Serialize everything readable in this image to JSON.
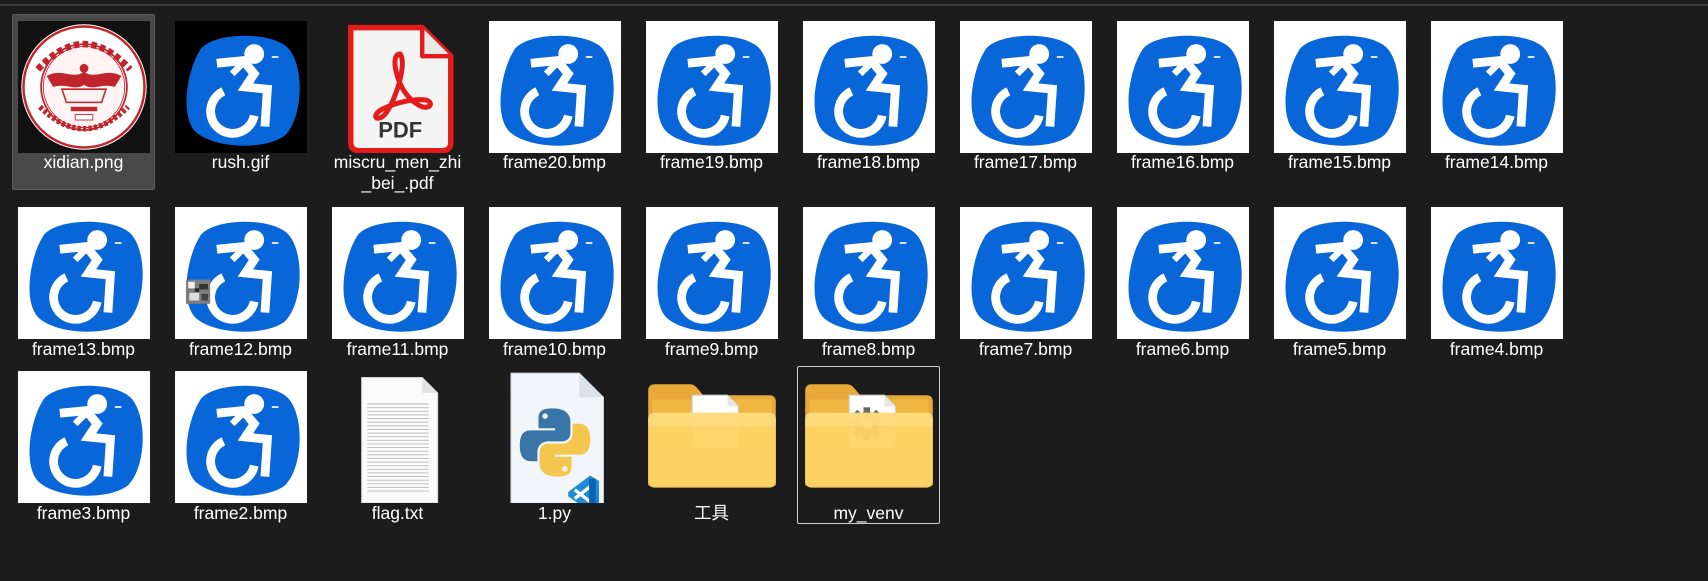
{
  "view": "large-icons",
  "colors": {
    "background": "#1c1c1c",
    "selection": "#494949",
    "icon_blue": "#0866d9",
    "text": "#ffffff"
  },
  "files": [
    {
      "name": "xidian.png",
      "icon": "xidian-logo-thumbnail",
      "kind": "logo",
      "state": "selected"
    },
    {
      "name": "rush.gif",
      "icon": "wheelchair-thumbnail",
      "kind": "gif"
    },
    {
      "name": "miscru_men_zhi_bei_.pdf",
      "icon": "pdf-file-icon",
      "kind": "pdf"
    },
    {
      "name": "frame20.bmp",
      "icon": "wheelchair-thumbnail",
      "kind": "frame"
    },
    {
      "name": "frame19.bmp",
      "icon": "wheelchair-thumbnail",
      "kind": "frame"
    },
    {
      "name": "frame18.bmp",
      "icon": "wheelchair-thumbnail",
      "kind": "frame"
    },
    {
      "name": "frame17.bmp",
      "icon": "wheelchair-thumbnail",
      "kind": "frame"
    },
    {
      "name": "frame16.bmp",
      "icon": "wheelchair-thumbnail",
      "kind": "frame"
    },
    {
      "name": "frame15.bmp",
      "icon": "wheelchair-thumbnail",
      "kind": "frame"
    },
    {
      "name": "frame14.bmp",
      "icon": "wheelchair-thumbnail",
      "kind": "frame"
    },
    {
      "name": "frame13.bmp",
      "icon": "wheelchair-thumbnail",
      "kind": "frame"
    },
    {
      "name": "frame12.bmp",
      "icon": "wheelchair-thumbnail",
      "kind": "frame12"
    },
    {
      "name": "frame11.bmp",
      "icon": "wheelchair-thumbnail",
      "kind": "frame"
    },
    {
      "name": "frame10.bmp",
      "icon": "wheelchair-thumbnail",
      "kind": "frame"
    },
    {
      "name": "frame9.bmp",
      "icon": "wheelchair-thumbnail",
      "kind": "frame"
    },
    {
      "name": "frame8.bmp",
      "icon": "wheelchair-thumbnail",
      "kind": "frame"
    },
    {
      "name": "frame7.bmp",
      "icon": "wheelchair-thumbnail",
      "kind": "frame"
    },
    {
      "name": "frame6.bmp",
      "icon": "wheelchair-thumbnail",
      "kind": "frame"
    },
    {
      "name": "frame5.bmp",
      "icon": "wheelchair-thumbnail",
      "kind": "frame"
    },
    {
      "name": "frame4.bmp",
      "icon": "wheelchair-thumbnail",
      "kind": "frame"
    },
    {
      "name": "frame3.bmp",
      "icon": "wheelchair-thumbnail",
      "kind": "frame"
    },
    {
      "name": "frame2.bmp",
      "icon": "wheelchair-thumbnail",
      "kind": "frame"
    },
    {
      "name": "flag.txt",
      "icon": "text-file-icon",
      "kind": "txt"
    },
    {
      "name": "1.py",
      "icon": "python-file-icon",
      "kind": "py"
    },
    {
      "name": "工具",
      "icon": "folder-icon",
      "kind": "folder"
    },
    {
      "name": "my_venv",
      "icon": "folder-settings-icon",
      "kind": "folder-gear",
      "state": "focused"
    }
  ]
}
